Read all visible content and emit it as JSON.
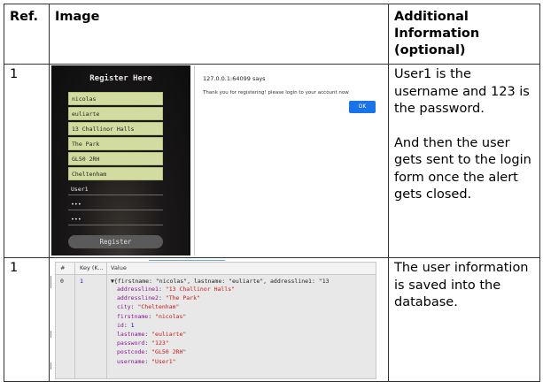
{
  "table": {
    "headers": {
      "ref": "Ref.",
      "image": "Image",
      "info": "Additional Information (optional)"
    }
  },
  "rows": [
    {
      "ref": "1",
      "info": [
        "User1 is the username and 123 is the password.",
        "And then the user gets sent to the login form once the alert gets closed."
      ]
    },
    {
      "ref": "1",
      "info": [
        "The user information is saved into the database."
      ]
    }
  ],
  "register_form": {
    "title": "Register Here",
    "fields": [
      "nicolas",
      "euliarte",
      "13 Challinor Halls",
      "The Park",
      "GL50 2RH",
      "Cheltenham"
    ],
    "plain_fields": [
      "User1",
      "•••",
      "•••"
    ],
    "button": "Register"
  },
  "alert": {
    "title": "127.0.0.1:64099 says",
    "message": "Thank you for registering! please login to your account now",
    "ok": "OK"
  },
  "db": {
    "headers": {
      "hash": "#",
      "key": "Key (K...",
      "value": "Value"
    },
    "row_index": "0",
    "row_key": "1",
    "summary": "▼{firstname: \"nicolas\", lastname: \"euliarte\", addressline1: \"13",
    "props": [
      {
        "k": "addressline1",
        "v": "\"13 Challinor Halls\"",
        "t": "s"
      },
      {
        "k": "addressline2",
        "v": "\"The Park\"",
        "t": "s"
      },
      {
        "k": "city",
        "v": "\"Cheltenham\"",
        "t": "s"
      },
      {
        "k": "firstname",
        "v": "\"nicolas\"",
        "t": "s"
      },
      {
        "k": "id",
        "v": "1",
        "t": "n"
      },
      {
        "k": "lastname",
        "v": "\"euliarte\"",
        "t": "s"
      },
      {
        "k": "password",
        "v": "\"123\"",
        "t": "s"
      },
      {
        "k": "postcode",
        "v": "\"GL50 2RH\"",
        "t": "s"
      },
      {
        "k": "username",
        "v": "\"User1\"",
        "t": "s"
      }
    ]
  }
}
